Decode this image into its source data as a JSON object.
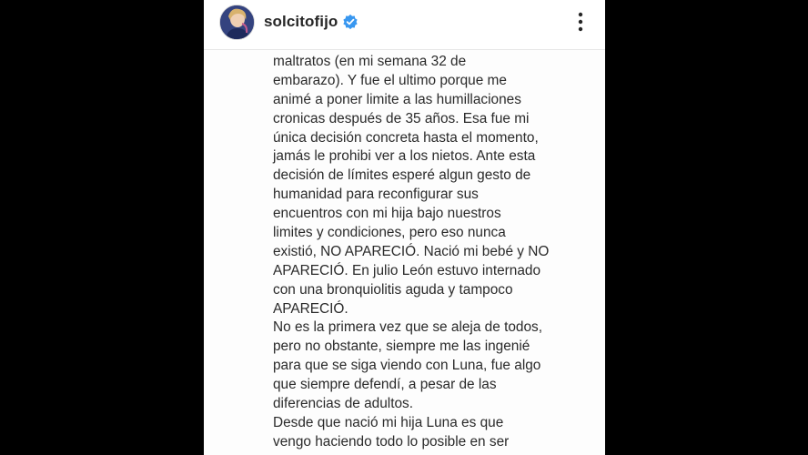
{
  "post": {
    "username": "solcitofijo",
    "verified": true,
    "avatar_icon": "profile-avatar",
    "more_icon": "more-vertical-icon",
    "verified_color": "#3897f0"
  },
  "caption": {
    "lines": [
      "maltratos (en mi semana 32 de",
      "embarazo). Y fue el ultimo porque me",
      "animé a poner limite a las humillaciones",
      "cronicas después de 35 años. Esa fue mi",
      "única decisión concreta hasta el momento,",
      "jamás le prohibi ver a los nietos. Ante esta",
      "decisión de límites esperé algun gesto de",
      "humanidad para reconfigurar sus",
      "encuentros con mi hija bajo nuestros",
      "limites y condiciones, pero eso nunca",
      "existió, NO APARECIÓ. Nació mi bebé y NO",
      "APARECIÓ. En julio León estuvo internado",
      "con una bronquiolitis aguda y tampoco",
      "APARECIÓ.",
      "No es la primera vez que se aleja de todos,",
      "pero no obstante, siempre me las ingenié",
      "para que se siga viendo con Luna, fue algo",
      "que siempre defendí, a pesar de las",
      "diferencias de adultos.",
      "Desde que nació mi hija Luna es que",
      "vengo haciendo todo lo posible en ser"
    ]
  }
}
